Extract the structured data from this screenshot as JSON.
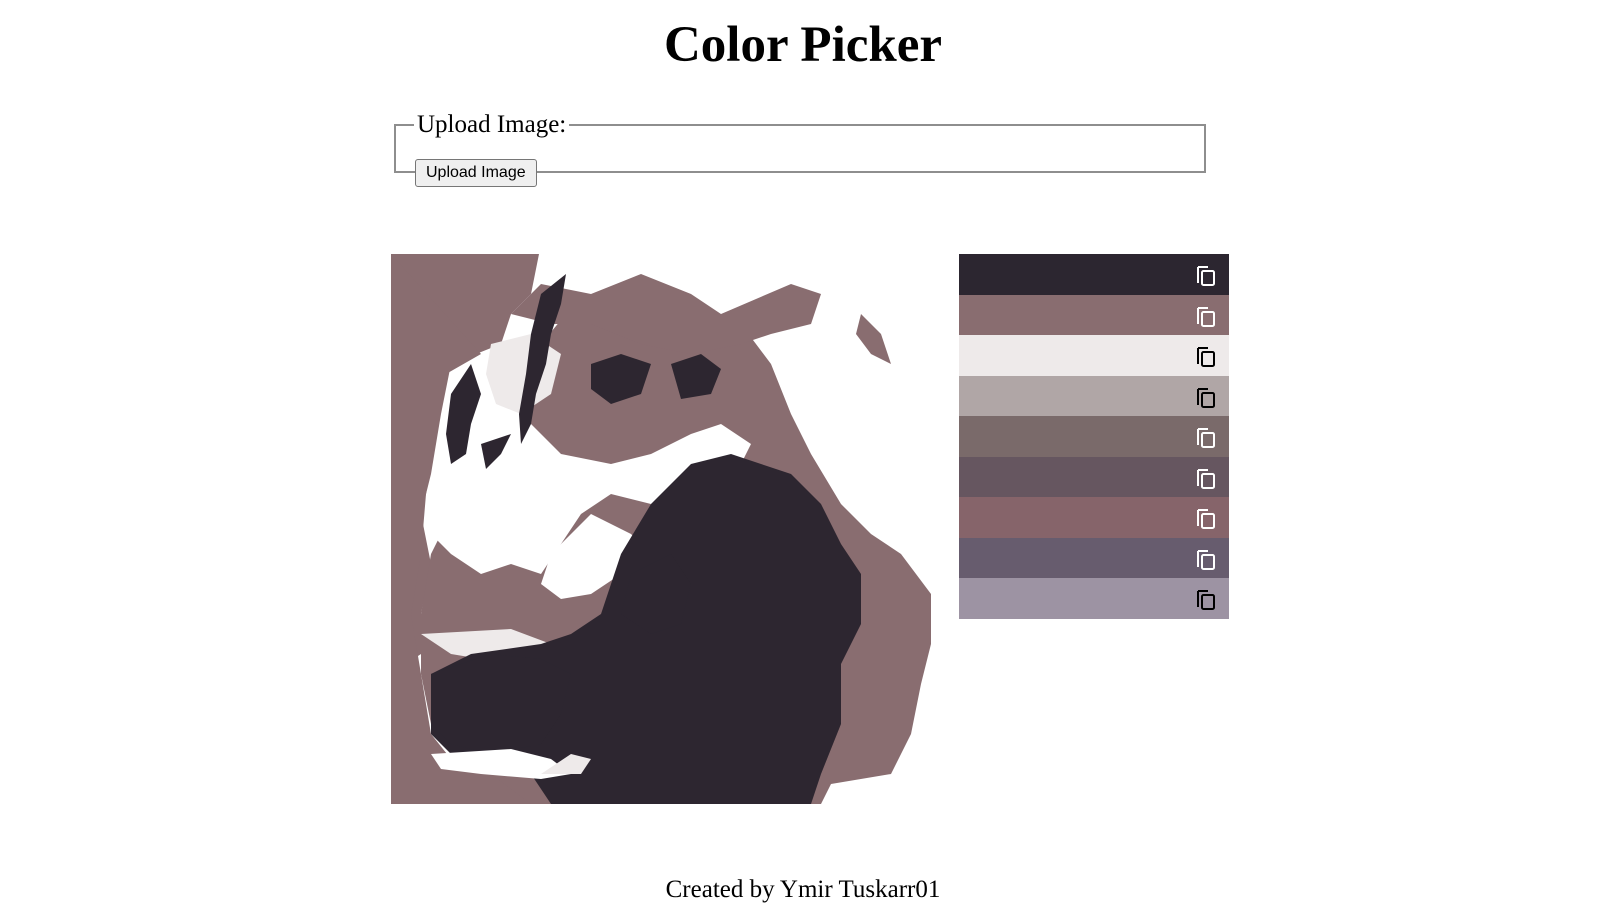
{
  "page": {
    "title": "Color Picker",
    "footer": "Created by Ymir Tuskarr01"
  },
  "upload": {
    "legend": "Upload Image:",
    "button_label": "Upload Image"
  },
  "image": {
    "description_colors": {
      "dark": "#2d2630",
      "mauve": "#896d70",
      "white": "#ffffff",
      "light": "#eeeaea"
    }
  },
  "palette": {
    "swatches": [
      {
        "color": "#2c2630",
        "icon": "copy-icon",
        "icon_color": "#ffffff"
      },
      {
        "color": "#896d70",
        "icon": "copy-icon",
        "icon_color": "#ffffff"
      },
      {
        "color": "#eeeaea",
        "icon": "copy-icon",
        "icon_color": "#000000"
      },
      {
        "color": "#b0a6a6",
        "icon": "copy-icon",
        "icon_color": "#000000"
      },
      {
        "color": "#7a6a6a",
        "icon": "copy-icon",
        "icon_color": "#ffffff"
      },
      {
        "color": "#665660",
        "icon": "copy-icon",
        "icon_color": "#ffffff"
      },
      {
        "color": "#86646a",
        "icon": "copy-icon",
        "icon_color": "#ffffff"
      },
      {
        "color": "#675c6e",
        "icon": "copy-icon",
        "icon_color": "#ffffff"
      },
      {
        "color": "#9d93a3",
        "icon": "copy-icon",
        "icon_color": "#000000"
      }
    ]
  }
}
